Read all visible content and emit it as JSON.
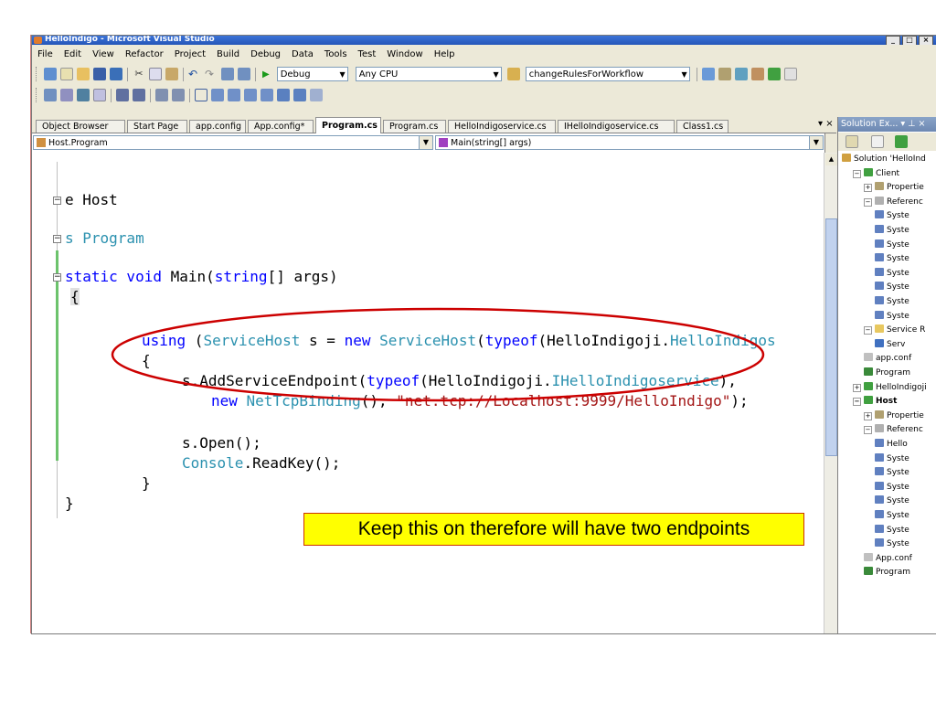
{
  "window": {
    "title": "HelloIndigo - Microsoft Visual Studio"
  },
  "menu": [
    "File",
    "Edit",
    "View",
    "Refactor",
    "Project",
    "Build",
    "Debug",
    "Data",
    "Tools",
    "Test",
    "Window",
    "Help"
  ],
  "toolbar": {
    "config": "Debug",
    "platform": "Any CPU",
    "workflow": "changeRulesForWorkflow"
  },
  "tabs": [
    "Object Browser",
    "Start Page",
    "app.config",
    "App.config*",
    "Program.cs",
    "Program.cs",
    "HelloIndigoservice.cs",
    "IHelloIndigoservice.cs",
    "Class1.cs"
  ],
  "active_tab_index": 4,
  "tab_close": "▾ ×",
  "nav": {
    "type": "Host.Program",
    "member": "Main(string[] args)"
  },
  "code": {
    "l1": "e Host",
    "l2": "s Program",
    "l3_kw": "static void",
    "l3_rest": " Main(",
    "l3_kw2": "string",
    "l3_end": "[] args)",
    "l4": "{",
    "l5_kw": "using",
    "l5_a": " (",
    "l5_ty": "ServiceHost",
    "l5_b": " s = ",
    "l5_kw2": "new",
    "l5_ty2": " ServiceHost",
    "l5_c": "(",
    "l5_kw3": "typeof",
    "l5_d": "(HelloIndigoji.",
    "l5_ty3": "HelloIndigos",
    "l6": "{",
    "l7_a": "s.AddServiceEndpoint(",
    "l7_kw": "typeof",
    "l7_b": "(HelloIndigoji.",
    "l7_ty": "IHelloIndigoservice",
    "l7_c": "),",
    "l8_kw": "new",
    "l8_ty": " NetTcpBinding",
    "l8_a": "(), ",
    "l8_st": "\"net.tcp://Localhost:9999/HelloIndigo\"",
    "l8_b": ");",
    "l9": "s.Open();",
    "l10_ty": "Console",
    "l10_a": ".ReadKey();",
    "l11": "}",
    "l12": "}"
  },
  "callout": "Keep this on therefore will have two endpoints",
  "solution_explorer": {
    "title": "Solution Ex... ▾ ⊥ ×",
    "items": [
      {
        "label": "Solution 'HelloInd",
        "level": 0,
        "icon": "solution-icon"
      },
      {
        "label": "Client",
        "level": 1,
        "icon": "project-icon",
        "expander": "-"
      },
      {
        "label": "Propertie",
        "level": 2,
        "icon": "properties-icon",
        "expander": "+"
      },
      {
        "label": "Referenc",
        "level": 2,
        "icon": "references-icon",
        "expander": "-"
      },
      {
        "label": "Syste",
        "level": 3,
        "icon": "reference-icon"
      },
      {
        "label": "Syste",
        "level": 3,
        "icon": "reference-icon"
      },
      {
        "label": "Syste",
        "level": 3,
        "icon": "reference-icon"
      },
      {
        "label": "Syste",
        "level": 3,
        "icon": "reference-icon"
      },
      {
        "label": "Syste",
        "level": 3,
        "icon": "reference-icon"
      },
      {
        "label": "Syste",
        "level": 3,
        "icon": "reference-icon"
      },
      {
        "label": "Syste",
        "level": 3,
        "icon": "reference-icon"
      },
      {
        "label": "Syste",
        "level": 3,
        "icon": "reference-icon"
      },
      {
        "label": "Service R",
        "level": 2,
        "icon": "folder-icon",
        "expander": "-"
      },
      {
        "label": "Serv",
        "level": 3,
        "icon": "service-icon"
      },
      {
        "label": "app.conf",
        "level": 2,
        "icon": "config-file-icon"
      },
      {
        "label": "Program",
        "level": 2,
        "icon": "cs-file-icon"
      },
      {
        "label": "HelloIndigoji",
        "level": 1,
        "icon": "project-icon",
        "expander": "+"
      },
      {
        "label": "Host",
        "level": 1,
        "icon": "project-icon",
        "expander": "-",
        "bold": true
      },
      {
        "label": "Propertie",
        "level": 2,
        "icon": "properties-icon",
        "expander": "+"
      },
      {
        "label": "Referenc",
        "level": 2,
        "icon": "references-icon",
        "expander": "-"
      },
      {
        "label": "Hello",
        "level": 3,
        "icon": "reference-icon"
      },
      {
        "label": "Syste",
        "level": 3,
        "icon": "reference-icon"
      },
      {
        "label": "Syste",
        "level": 3,
        "icon": "reference-icon"
      },
      {
        "label": "Syste",
        "level": 3,
        "icon": "reference-icon"
      },
      {
        "label": "Syste",
        "level": 3,
        "icon": "reference-icon"
      },
      {
        "label": "Syste",
        "level": 3,
        "icon": "reference-icon"
      },
      {
        "label": "Syste",
        "level": 3,
        "icon": "reference-icon"
      },
      {
        "label": "Syste",
        "level": 3,
        "icon": "reference-icon"
      },
      {
        "label": "App.conf",
        "level": 2,
        "icon": "config-file-icon"
      },
      {
        "label": "Program",
        "level": 2,
        "icon": "cs-file-icon"
      }
    ]
  },
  "colors": {
    "keyword": "#0000ff",
    "type": "#2b91af",
    "string": "#a31515",
    "callout_bg": "#ffff00",
    "ellipse": "#cc0000"
  }
}
